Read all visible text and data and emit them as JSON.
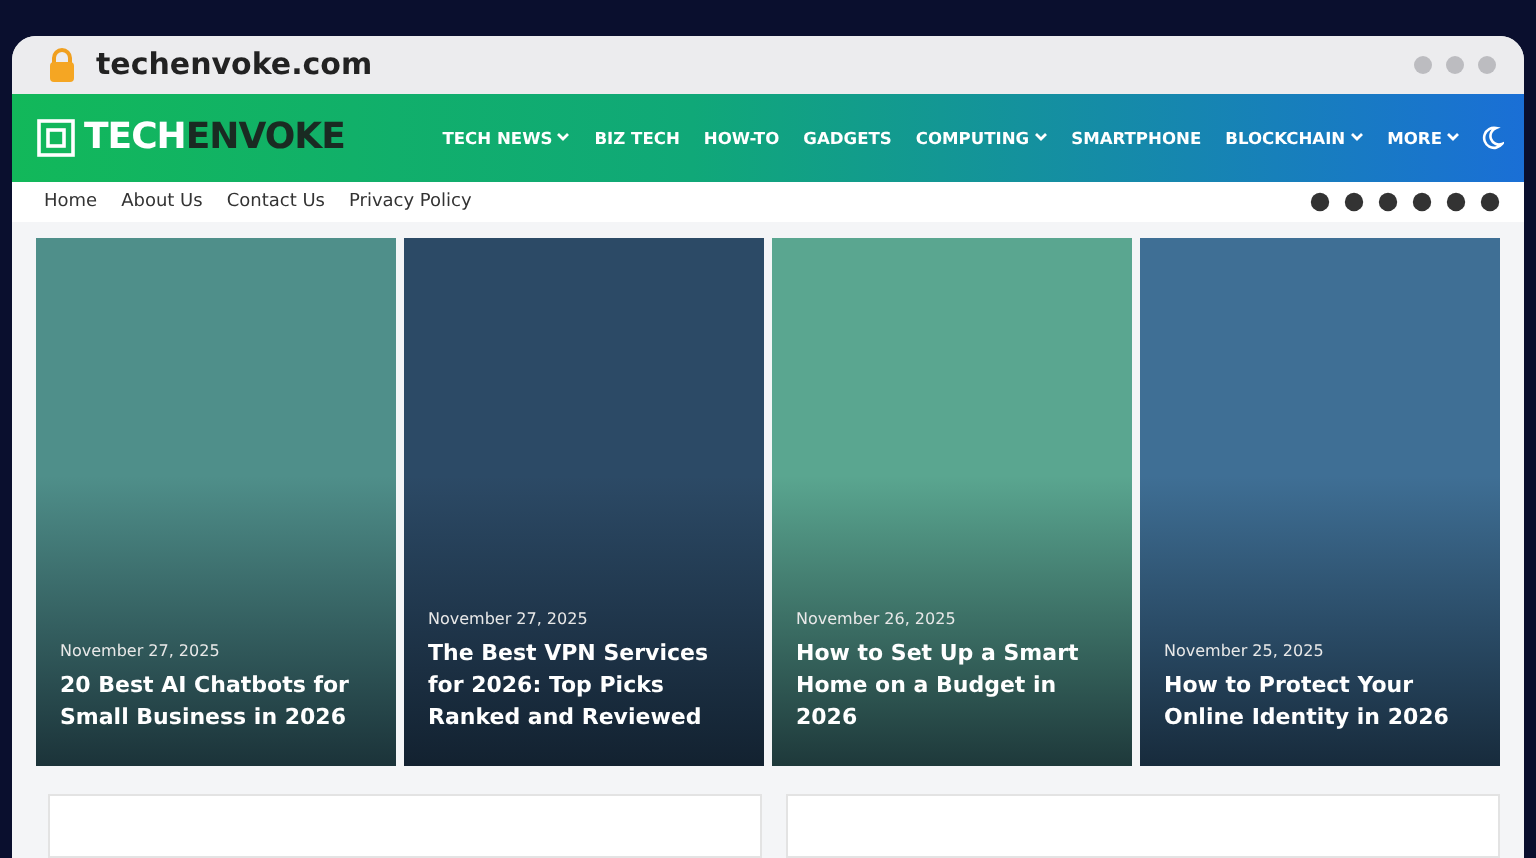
{
  "browser": {
    "url": "techenvoke.com"
  },
  "header": {
    "logo_light": "TECH",
    "logo_dark": "ENVOKE",
    "nav": [
      {
        "label": "TECH NEWS",
        "dropdown": true
      },
      {
        "label": "BIZ TECH",
        "dropdown": false
      },
      {
        "label": "HOW-TO",
        "dropdown": false
      },
      {
        "label": "GADGETS",
        "dropdown": false
      },
      {
        "label": "COMPUTING",
        "dropdown": true
      },
      {
        "label": "SMARTPHONE",
        "dropdown": false
      },
      {
        "label": "BLOCKCHAIN",
        "dropdown": true
      },
      {
        "label": "MORE",
        "dropdown": true
      }
    ]
  },
  "subnav": {
    "links": [
      "Home",
      "About Us",
      "Contact Us",
      "Privacy Policy"
    ]
  },
  "featured": [
    {
      "date": "November 27, 2025",
      "title": "20 Best AI Chatbots for Small Business in 2026",
      "color": "#4f8f8a"
    },
    {
      "date": "November 27, 2025",
      "title": "The Best VPN Services for 2026: Top Picks Ranked and Reviewed",
      "color": "#2c4a66"
    },
    {
      "date": "November 26, 2025",
      "title": "How to Set Up a Smart Home on a Budget in 2026",
      "color": "#5aa690"
    },
    {
      "date": "November 25, 2025",
      "title": "How to Protect Your Online Identity in 2026",
      "color": "#3f6f95"
    }
  ]
}
